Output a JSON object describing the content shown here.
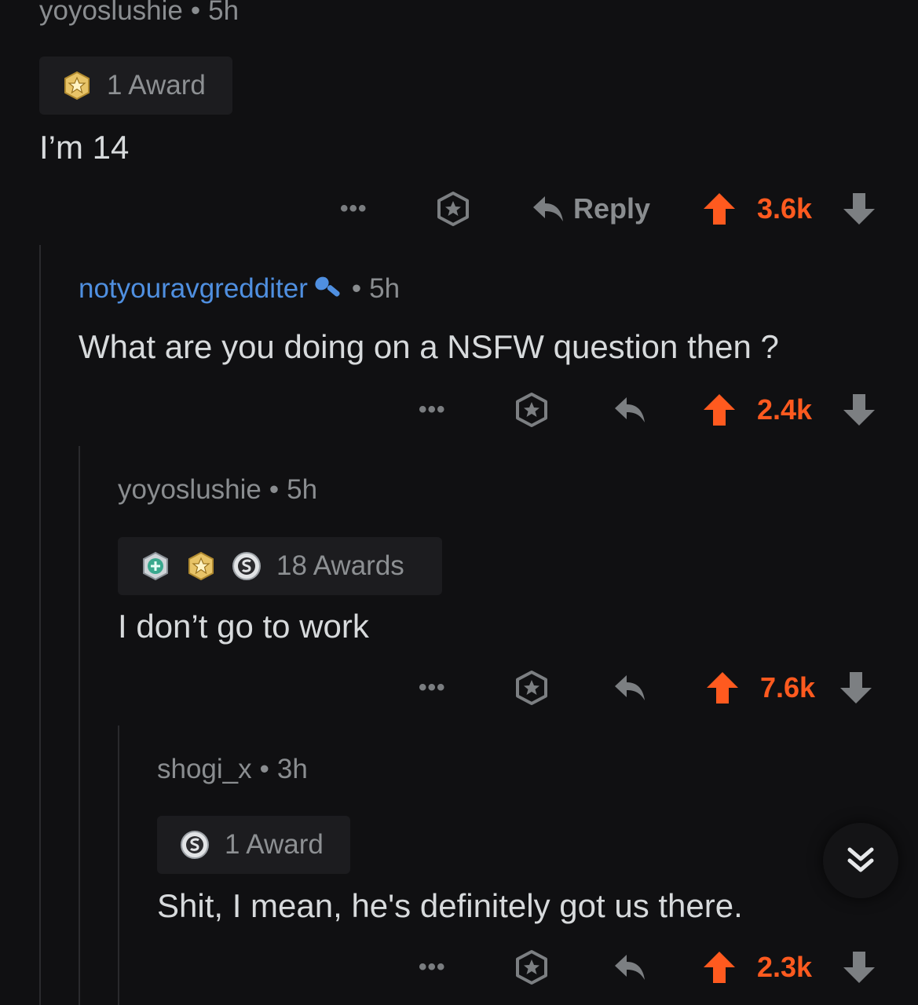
{
  "comments": [
    {
      "username": "yoyoslushie",
      "separator": "•",
      "time": "5h",
      "awards_label": "1 Award",
      "text": "I’m 14",
      "reply_label": "Reply",
      "score": "3.6k"
    },
    {
      "username": "notyouravgredditer",
      "separator": "•",
      "time": "5h",
      "text": "What are you doing on a NSFW question then ?",
      "score": "2.4k"
    },
    {
      "username": "yoyoslushie",
      "separator": "•",
      "time": "5h",
      "awards_label": "18 Awards",
      "text": "I don’t go to work",
      "score": "7.6k"
    },
    {
      "username": "shogi_x",
      "separator": "•",
      "time": "3h",
      "awards_label": "1 Award",
      "text": "Shit, I mean, he's definitely got us there.",
      "score": "2.3k"
    }
  ],
  "colors": {
    "background": "#101012",
    "upvote": "#ff5a1f",
    "username_highlight": "#4f8fe0",
    "muted_text": "#8a8d90"
  },
  "icons": {
    "more": "more-icon",
    "award": "award-icon",
    "reply": "reply-icon",
    "upvote": "upvote-arrow-icon",
    "downvote": "downvote-arrow-icon",
    "collapse": "double-chevron-down-icon"
  }
}
